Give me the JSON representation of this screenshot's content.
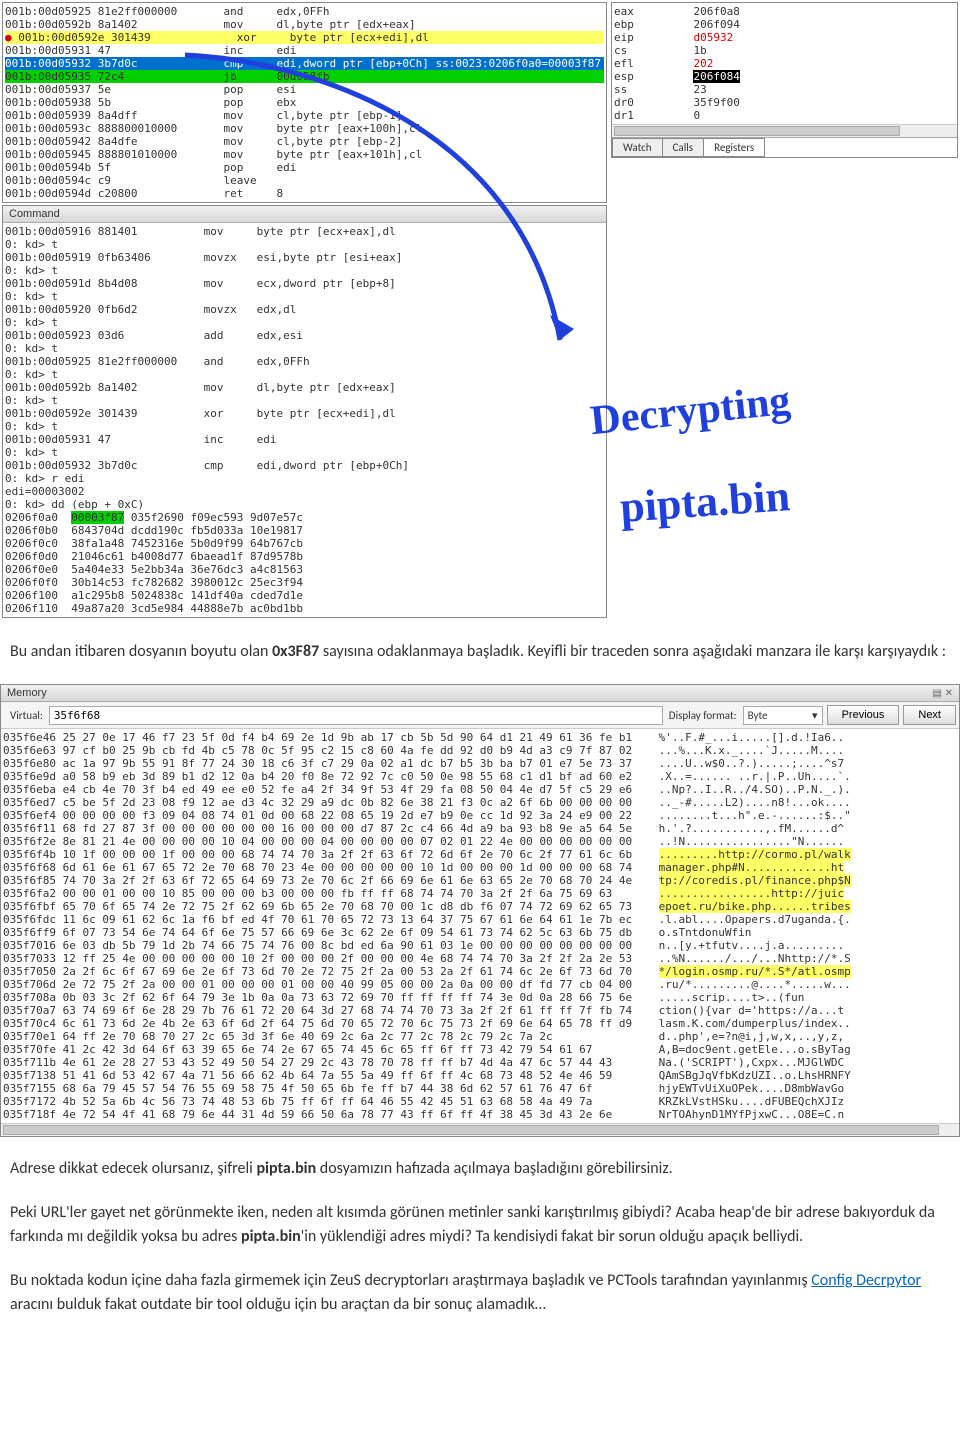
{
  "disasm": [
    {
      "a": "001b:00d05925 81e2ff000000",
      "op": "and",
      "args": "edx,0FFh",
      "hl": ""
    },
    {
      "a": "001b:00d0592b 8a1402",
      "op": "mov",
      "args": "dl,byte ptr [edx+eax]",
      "hl": ""
    },
    {
      "a": "001b:00d0592e 301439",
      "op": "xor",
      "args": "byte ptr [ecx+edi],dl",
      "hl": "yel",
      "bp": true
    },
    {
      "a": "001b:00d05931 47",
      "op": "inc",
      "args": "edi",
      "hl": ""
    },
    {
      "a": "001b:00d05932 3b7d0c",
      "op": "cmp",
      "args": "edi,dword ptr [ebp+0Ch] ss:0023:0206f0a0=00003f87",
      "hl": "blu"
    },
    {
      "a": "001b:00d05935 72c4",
      "op": "jb",
      "args": "00d058fb",
      "hl": "grn"
    },
    {
      "a": "001b:00d05937 5e",
      "op": "pop",
      "args": "esi",
      "hl": ""
    },
    {
      "a": "001b:00d05938 5b",
      "op": "pop",
      "args": "ebx",
      "hl": ""
    },
    {
      "a": "001b:00d05939 8a4dff",
      "op": "mov",
      "args": "cl,byte ptr [ebp-1]",
      "hl": ""
    },
    {
      "a": "001b:00d0593c 888800010000",
      "op": "mov",
      "args": "byte ptr [eax+100h],cl",
      "hl": ""
    },
    {
      "a": "001b:00d05942 8a4dfe",
      "op": "mov",
      "args": "cl,byte ptr [ebp-2]",
      "hl": ""
    },
    {
      "a": "001b:00d05945 888801010000",
      "op": "mov",
      "args": "byte ptr [eax+101h],cl",
      "hl": ""
    },
    {
      "a": "001b:00d0594b 5f",
      "op": "pop",
      "args": "edi",
      "hl": ""
    },
    {
      "a": "001b:00d0594c c9",
      "op": "leave",
      "args": "",
      "hl": ""
    },
    {
      "a": "001b:00d0594d c20800",
      "op": "ret",
      "args": "8",
      "hl": ""
    }
  ],
  "regs": [
    {
      "n": "eax",
      "v": "206f0a8"
    },
    {
      "n": "ebp",
      "v": "206f094"
    },
    {
      "n": "eip",
      "v": "d05932",
      "red": true
    },
    {
      "n": "cs",
      "v": "1b"
    },
    {
      "n": "efl",
      "v": "202",
      "red": true
    },
    {
      "n": "esp",
      "v": "206f084",
      "inv": true
    },
    {
      "n": "ss",
      "v": "23"
    },
    {
      "n": "dr0",
      "v": "35f9f00"
    },
    {
      "n": "dr1",
      "v": "0"
    }
  ],
  "regtabs": [
    "Watch",
    "Calls",
    "Registers"
  ],
  "cmdhdr": "Command",
  "cmd": [
    "001b:00d05916 881401          mov     byte ptr [ecx+eax],dl",
    "0: kd> t",
    "001b:00d05919 0fb63406        movzx   esi,byte ptr [esi+eax]",
    "0: kd> t",
    "001b:00d0591d 8b4d08          mov     ecx,dword ptr [ebp+8]",
    "0: kd> t",
    "001b:00d05920 0fb6d2          movzx   edx,dl",
    "0: kd> t",
    "001b:00d05923 03d6            add     edx,esi",
    "0: kd> t",
    "001b:00d05925 81e2ff000000    and     edx,0FFh",
    "0: kd> t",
    "001b:00d0592b 8a1402          mov     dl,byte ptr [edx+eax]",
    "0: kd> t",
    "001b:00d0592e 301439          xor     byte ptr [ecx+edi],dl",
    "0: kd> t",
    "001b:00d05931 47              inc     edi",
    "0: kd> t",
    "001b:00d05932 3b7d0c          cmp     edi,dword ptr [ebp+0Ch]",
    "0: kd> r edi",
    "edi=00003002",
    "0: kd> dd (ebp + 0xC)"
  ],
  "dump": [
    {
      "a": "0206f0a0",
      "w": [
        "00003f87",
        "035f2690",
        "f09ec593",
        "9d07e57c"
      ],
      "hl0": true
    },
    {
      "a": "0206f0b0",
      "w": [
        "6843704d",
        "dcdd190c",
        "fb5d033a",
        "10e19817"
      ]
    },
    {
      "a": "0206f0c0",
      "w": [
        "38fa1a48",
        "7452316e",
        "5b0d9f99",
        "64b767cb"
      ]
    },
    {
      "a": "0206f0d0",
      "w": [
        "21046c61",
        "b4008d77",
        "6baead1f",
        "87d9578b"
      ]
    },
    {
      "a": "0206f0e0",
      "w": [
        "5a404e33",
        "5e2bb34a",
        "36e76dc3",
        "a4c81563"
      ]
    },
    {
      "a": "0206f0f0",
      "w": [
        "30b14c53",
        "fc782682",
        "3980012c",
        "25ec3f94"
      ]
    },
    {
      "a": "0206f100",
      "w": [
        "a1c295b8",
        "5024838c",
        "141df40a",
        "cded7d1e"
      ]
    },
    {
      "a": "0206f110",
      "w": [
        "49a87a20",
        "3cd5e984",
        "44888e7b",
        "ac0bd1bb"
      ]
    }
  ],
  "para1_a": "Bu andan itibaren dosyanın boyutu olan ",
  "para1_b": "0x3F87",
  "para1_c": " sayısına odaklanmaya başladık. Keyifli bir traceden sonra aşağıdaki manzara ile karşı karşıyaydık :",
  "memhdr": "Memory",
  "virtlbl": "Virtual:",
  "virtval": "35f6f68",
  "dfmtlbl": "Display format:",
  "dfmtval": "Byte",
  "prevbtn": "Previous",
  "nextbtn": "Next",
  "hex": [
    {
      "a": "035f6e46",
      "h": "25 27 0e 17 46 f7 23 5f 0d f4 b4 69 2e 1d 9b ab 17 cb 5b 5d 90 64 d1 21 49 61 36 fe b1",
      "t": "%'..F.#_...i.....[].d.!Ia6..",
      "hl": false
    },
    {
      "a": "035f6e63",
      "h": "97 cf b0 25 9b cb fd 4b c5 78 0c 5f 95 c2 15 c8 60 4a fe dd 92 d0 b9 4d a3 c9 7f 87 02",
      "t": "...%...K.x._....`J.....M....",
      "hl": false
    },
    {
      "a": "035f6e80",
      "h": "ac 1a 97 9b 55 91 8f 77 24 30 18 c6 3f c7 29 0a 02 a1 dc b7 b5 3b ba b7 01 e7 5e 73 37",
      "t": "....U..w$0..?.).....;....^s7",
      "hl": false
    },
    {
      "a": "035f6e9d",
      "h": "a0 58 b9 eb 3d 89 b1 d2 12 0a b4 20 f0 8e 72 92 7c c0 50 0e 98 55 68 c1 d1 bf ad 60 e2",
      "t": ".X..=...... ..r.|.P..Uh....`.",
      "hl": false
    },
    {
      "a": "035f6eba",
      "h": "e4 cb 4e 70 3f b4 ed 49 ee e0 52 fe a4 2f 34 9f 53 4f 29 fa 08 50 04 4e d7 5f c5 29 e6",
      "t": "..Np?..I..R../4.SO)..P.N._.).",
      "hl": false
    },
    {
      "a": "035f6ed7",
      "h": "c5 be 5f 2d 23 08 f9 12 ae d3 4c 32 29 a9 dc 0b 82 6e 38 21 f3 0c a2 6f 6b 00 00 00 00",
      "t": ".._-#.....L2)....n8!...ok....",
      "hl": false
    },
    {
      "a": "035f6ef4",
      "h": "00 00 00 00 f3 09 04 08 74 01 0d 00 68 22 08 65 19 2d e7 b9 0e cc 1d 92 3a 24 e9 00 22",
      "t": "........t...h\".e.-......:$..\"",
      "hl": false
    },
    {
      "a": "035f6f11",
      "h": "68 fd 27 87 3f 00 00 00 00 00 00 16 00 00 00 d7 87 2c c4 66 4d a9 ba 93 b8 9e a5 64 5e",
      "t": "h.'.?...........,.fM......d^",
      "hl": false
    },
    {
      "a": "035f6f2e",
      "h": "8e 81 21 4e 00 00 00 00 10 04 00 00 00 04 00 00 00 00 07 02 01 22 4e 00 00 00 00 00 00",
      "t": "..!N................\"N......",
      "hl": false
    },
    {
      "a": "035f6f4b",
      "h": "10 1f 00 00 00 1f 00 00 00 68 74 74 70 3a 2f 2f 63 6f 72 6d 6f 2e 70 6c 2f 77 61 6c 6b",
      "t": ".........http://cormo.pl/walk",
      "hl": true
    },
    {
      "a": "035f6f68",
      "h": "6d 61 6e 61 67 65 72 2e 70 68 70 23 4e 00 00 00 00 00 10 1d 00 00 00 1d 00 00 00 68 74",
      "t": "manager.php#N.............ht",
      "hl": true
    },
    {
      "a": "035f6f85",
      "h": "74 70 3a 2f 2f 63 6f 72 65 64 69 73 2e 70 6c 2f 66 69 6e 61 6e 63 65 2e 70 68 70 24 4e",
      "t": "tp://coredis.pl/finance.php$N",
      "hl": true
    },
    {
      "a": "035f6fa2",
      "h": "00 00 01 00 00 10 85 00 00 00 b3 00 00 00 fb ff ff 68 74 74 70 3a 2f 2f 6a 75 69 63",
      "t": ".................http://juic",
      "hl": true
    },
    {
      "a": "035f6fbf",
      "h": "65 70 6f 65 74 2e 72 75 2f 62 69 6b 65 2e 70 68 70 00 1c d8 db f6 07 74 72 69 62 65 73",
      "t": "epoet.ru/bike.php......tribes",
      "hl": true
    },
    {
      "a": "035f6fdc",
      "h": "11 6c 09 61 62 6c 1a f6 bf ed 4f 70 61 70 65 72 73 13 64 37 75 67 61 6e 64 61 1e 7b ec",
      "t": ".l.abl....Opapers.d7uganda.{.",
      "hl": false
    },
    {
      "a": "035f6ff9",
      "h": "6f 07 73 54 6e 74 64 6f 6e 75 57 66 69 6e 3c 62 2e 6f 09 54 61 73 74 62 5c 63 6b 75 db",
      "t": "o.sTntdonuWfin<b.o.Tastb\\cku.",
      "hl": false
    },
    {
      "a": "035f7016",
      "h": "6e 03 db 5b 79 1d 2b 74 66 75 74 76 00 8c bd ed 6a 90 61 03 1e 00 00 00 00 00 00 00 00",
      "t": "n..[y.+tfutv....j.a.........",
      "hl": false
    },
    {
      "a": "035f7033",
      "h": "12 ff 25 4e 00 00 00 00 00 10 2f 00 00 00 2f 00 00 00 4e 68 74 74 70 3a 2f 2f 2a 2e 53",
      "t": "..%N....../.../...Nhttp://*.S",
      "hl": false
    },
    {
      "a": "035f7050",
      "h": "2a 2f 6c 6f 67 69 6e 2e 6f 73 6d 70 2e 72 75 2f 2a 00 53 2a 2f 61 74 6c 2e 6f 73 6d 70",
      "t": "*/login.osmp.ru/*.S*/atl.osmp",
      "hl": true
    },
    {
      "a": "035f706d",
      "h": "2e 72 75 2f 2a 00 00 01 00 00 00 01 00 00 40 99 05 00 00 2a 0a 00 00 df fd 77 cb 04 00",
      "t": ".ru/*.........@....*.....w...",
      "hl": false
    },
    {
      "a": "035f708a",
      "h": "0b 03 3c 2f 62 6f 64 79 3e 1b 0a 0a 73 63 72 69 70 ff ff ff ff 74 3e 0d 0a 28 66 75 6e",
      "t": "..</body>...scrip....t>..(fun",
      "hl": false
    },
    {
      "a": "035f70a7",
      "h": "63 74 69 6f 6e 28 29 7b 76 61 72 20 64 3d 27 68 74 74 70 73 3a 2f 2f 61 ff ff 7f fb 74",
      "t": "ction(){var d='https://a...t",
      "hl": false
    },
    {
      "a": "035f70c4",
      "h": "6c 61 73 6d 2e 4b 2e 63 6f 6d 2f 64 75 6d 70 65 72 70 6c 75 73 2f 69 6e 64 65 78 ff d9",
      "t": "lasm.K.com/dumperplus/index..",
      "hl": false
    },
    {
      "a": "035f70e1",
      "h": "64 ff 2e 70 68 70 27 2c 65 3d 3f 6e 40 69 2c 6a 2c 77 2c 78 2c 79 2c 7a 2c",
      "t": "d..php',e=?n@i,j,w,x,..,y,z,",
      "hl": false
    },
    {
      "a": "035f70fe",
      "h": "41 2c 42 3d 64 6f 63 39 65 6e 74 2e 67 65 74 45 6c 65 ff 6f ff 73 42 79 54 61 67",
      "t": "A,B=doc9ent.getEle...o.sByTag",
      "hl": false
    },
    {
      "a": "035f711b",
      "h": "4e 61 2e 28 27 53 43 52 49 50 54 27 29 2c 43 78 70 78 ff ff b7 4d 4a 47 6c 57 44 43",
      "t": "Na.('SCRIPT'),Cxpx...MJGlWDC",
      "hl": false
    },
    {
      "a": "035f7138",
      "h": "51 41 6d 53 42 67 4a 71 56 66 62 4b 64 7a 55 5a 49 ff 6f ff 4c 68 73 48 52 4e 46 59",
      "t": "QAmSBgJqVfbKdzUZI..o.LhsHRNFY",
      "hl": false
    },
    {
      "a": "035f7155",
      "h": "68 6a 79 45 57 54 76 55 69 58 75 4f 50 65 6b fe ff b7 44 38 6d 62 57 61 76 47 6f",
      "t": "hjyEWTvUiXuOPek....D8mbWavGo",
      "hl": false
    },
    {
      "a": "035f7172",
      "h": "4b 52 5a 6b 4c 56 73 74 48 53 6b 75 ff 6f ff 64 46 55 42 45 51 63 68 58 4a 49 7a",
      "t": "KRZkLVstHSku....dFUBEQchXJIz",
      "hl": false
    },
    {
      "a": "035f718f",
      "h": "4e 72 54 4f 41 68 79 6e 44 31 4d 59 66 50 6a 78 77 43 ff 6f ff 4f 38 45 3d 43 2e 6e",
      "t": "NrTOAhynD1MYfPjxwC...O8E=C.n",
      "hl": false
    }
  ],
  "para2_a": "Adrese dikkat edecek olursanız, şifreli ",
  "para2_b": "pipta.bin",
  "para2_c": " dosyamızın hafızada açılmaya başladığını görebilirsiniz.",
  "para3_a": "Peki URL'ler gayet net görünmekte iken, neden alt kısımda görünen metinler sanki karıştırılmış gibiydi? Acaba heap'de bir adrese bakıyorduk da farkında mı değildik yoksa bu adres ",
  "para3_b": "pipta.bin",
  "para3_c": "'in yüklendiği adres miydi? Ta kendisiydi fakat bir sorun olduğu apaçık belliydi.",
  "para4_a": "Bu noktada kodun içine daha fazla girmemek için ZeuS decryptorları araştırmaya başladık ve PCTools tarafından yayınlanmış ",
  "para4_link": "Config Decrpytor",
  "para4_b": " aracını bulduk fakat outdate bir tool olduğu için bu araçtan da bir sonuç alamadık…",
  "hand1": "Decrypting",
  "hand2": "pipta.bin"
}
